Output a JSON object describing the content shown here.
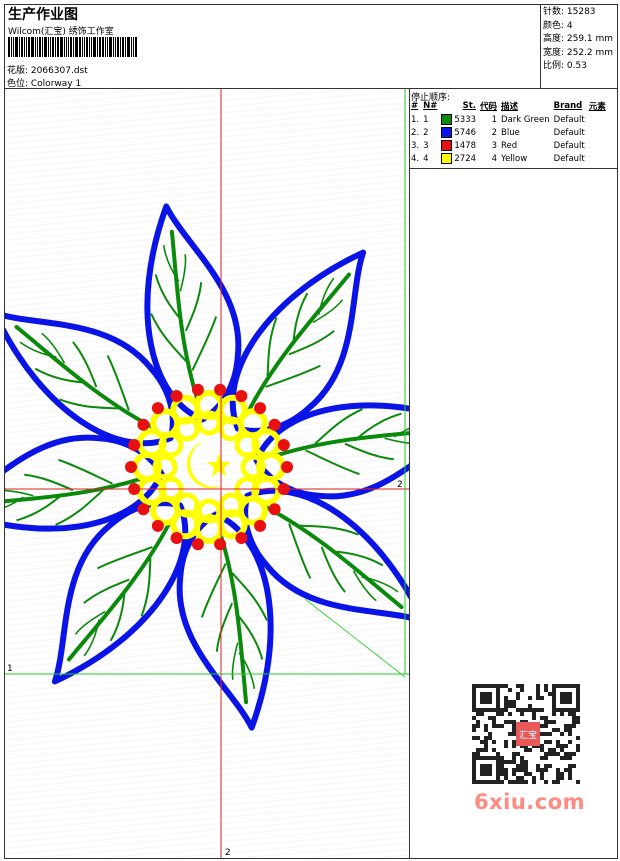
{
  "header": {
    "title": "生产作业图",
    "subtitle": "Wilcom(汇宝) 绣饰工作室",
    "design_label": "花版: 2066307.dst",
    "colorway_label": "色位: Colorway 1"
  },
  "stats": {
    "stitches": "针数: 15283",
    "colors": "颜色: 4",
    "height": "高度: 259.1 mm",
    "width": "宽度: 252.2 mm",
    "scale": "比例: 0.53"
  },
  "stop_sequence": {
    "title": "停止顺序:",
    "headers": [
      "#",
      "N#",
      "St.",
      "代码",
      "描述",
      "Brand",
      "元素"
    ],
    "rows": [
      {
        "index": "1.",
        "n": "1",
        "stitches": "5333",
        "code": "1",
        "description": "Dark Green",
        "brand": "Default",
        "color": "#0a8a0a"
      },
      {
        "index": "2.",
        "n": "2",
        "stitches": "5746",
        "code": "2",
        "description": "Blue",
        "brand": "Default",
        "color": "#0a14e6"
      },
      {
        "index": "3.",
        "n": "3",
        "stitches": "1478",
        "code": "3",
        "description": "Red",
        "brand": "Default",
        "color": "#e81010"
      },
      {
        "index": "4.",
        "n": "4",
        "stitches": "2724",
        "code": "4",
        "description": "Yellow",
        "brand": "Default",
        "color": "#ffff00"
      }
    ]
  },
  "guides": {
    "label_right": "2",
    "label_bottom": "2",
    "label_left": "1"
  },
  "colors": {
    "green": "#0a8a0a",
    "blue": "#0a14e6",
    "red": "#e81010",
    "yellow": "#ffff00",
    "guide_red": "#dd2222",
    "guide_green": "#22cc22"
  },
  "watermark": "6xiu.com",
  "qr_stamp": "汇宝"
}
